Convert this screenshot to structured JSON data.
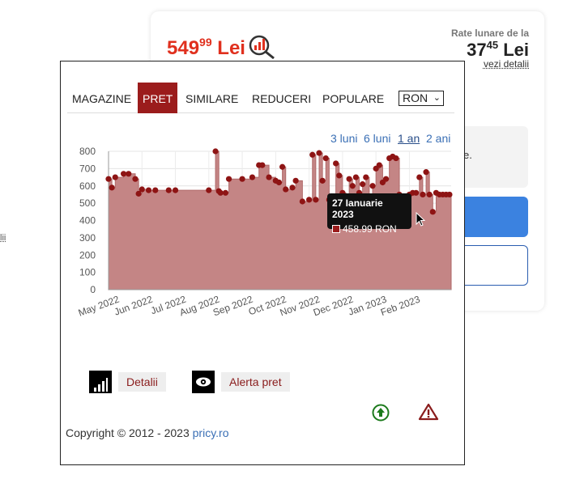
{
  "card": {
    "price_int": "549",
    "price_dec": "99",
    "price_currency": "Lei",
    "rate_label": "Rate lunare de la",
    "rate_int": "37",
    "rate_dec": "45",
    "rate_currency": "Lei",
    "rate_link": "vezi detalii",
    "grey_text": "e.",
    "left_fragment": "lii"
  },
  "tabs": [
    {
      "label": "MAGAZINE",
      "active": false
    },
    {
      "label": "PRET",
      "active": true
    },
    {
      "label": "SIMILARE",
      "active": false
    },
    {
      "label": "REDUCERI",
      "active": false
    },
    {
      "label": "POPULARE",
      "active": false
    }
  ],
  "currency": {
    "selected": "RON"
  },
  "ranges": [
    {
      "label": "3 luni",
      "active": false
    },
    {
      "label": "6 luni",
      "active": false
    },
    {
      "label": "1 an",
      "active": true
    },
    {
      "label": "2 ani",
      "active": false
    }
  ],
  "tooltip": {
    "date": "27 Ianuarie 2023",
    "value": "458.99 RON"
  },
  "actions": {
    "details": "Detalii",
    "alert": "Alerta pret"
  },
  "footer": {
    "copyright": "Copyright © 2012 - 2023 ",
    "brand": "pricy.ro"
  },
  "colors": {
    "accent": "#9b1c1c",
    "area": "#c48585",
    "price": "#e0301e",
    "link": "#3a6fb5"
  },
  "chart_data": {
    "type": "area",
    "title": "",
    "xlabel": "",
    "ylabel": "",
    "ylim": [
      0,
      800
    ],
    "yticks": [
      0,
      100,
      200,
      300,
      400,
      500,
      600,
      700,
      800
    ],
    "xticks": [
      "May 2022",
      "Jun 2022",
      "Jul 2022",
      "Aug 2022",
      "Sep 2022",
      "Oct 2022",
      "Nov 2022",
      "Dec 2022",
      "Jan 2023",
      "Feb 2023"
    ],
    "x": [
      0.0,
      0.1,
      0.2,
      0.45,
      0.6,
      0.8,
      0.9,
      1.0,
      1.2,
      1.4,
      1.8,
      2.0,
      3.0,
      3.2,
      3.3,
      3.35,
      3.5,
      3.6,
      4.0,
      4.3,
      4.5,
      4.6,
      4.8,
      5.0,
      5.1,
      5.2,
      5.3,
      5.5,
      5.6,
      5.8,
      6.0,
      6.1,
      6.2,
      6.3,
      6.4,
      6.5,
      6.6,
      6.8,
      6.9,
      7.0,
      7.1,
      7.2,
      7.3,
      7.4,
      7.5,
      7.6,
      7.7,
      7.8,
      7.9,
      8.0,
      8.1,
      8.2,
      8.3,
      8.4,
      8.5,
      8.6,
      8.7,
      8.8,
      8.9,
      9.0,
      9.1,
      9.2,
      9.3,
      9.4,
      9.5,
      9.6,
      9.7,
      9.8,
      9.9,
      10.0,
      10.1,
      10.2
    ],
    "values": [
      640,
      590,
      650,
      670,
      670,
      640,
      555,
      580,
      575,
      575,
      575,
      575,
      575,
      800,
      570,
      560,
      560,
      640,
      640,
      650,
      720,
      720,
      650,
      630,
      620,
      710,
      580,
      590,
      630,
      510,
      520,
      780,
      520,
      790,
      630,
      760,
      520,
      730,
      660,
      560,
      520,
      640,
      600,
      650,
      560,
      610,
      650,
      520,
      600,
      700,
      720,
      620,
      640,
      760,
      770,
      760,
      550,
      500,
      459,
      550,
      560,
      560,
      650,
      550,
      680,
      550,
      450,
      560,
      550,
      550,
      550,
      550
    ]
  }
}
